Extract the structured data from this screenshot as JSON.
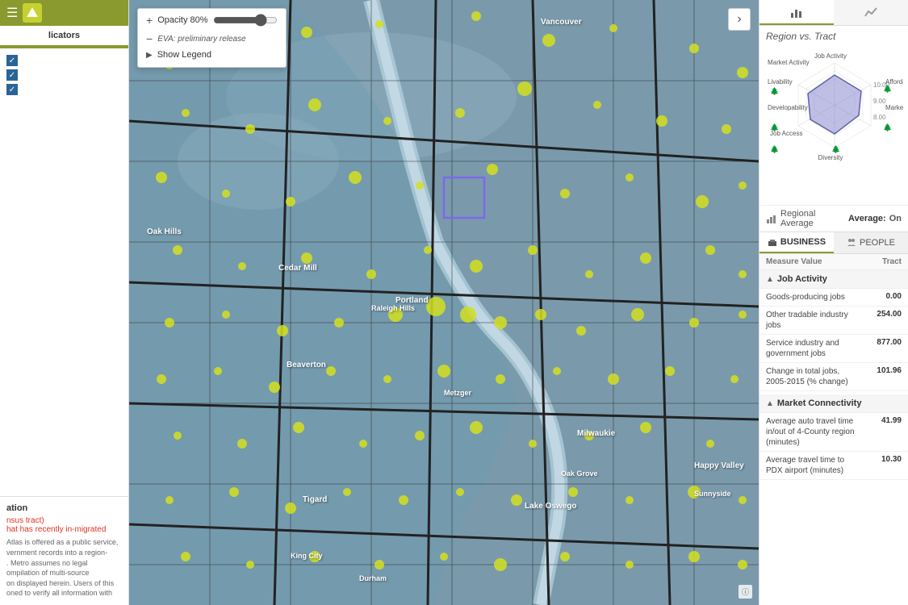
{
  "left_panel": {
    "indicators_title": "licators",
    "checkboxes": [
      {
        "id": "cb1",
        "checked": true
      },
      {
        "id": "cb2",
        "checked": true
      },
      {
        "id": "cb3",
        "checked": true
      }
    ],
    "bottom_info": {
      "title": "ation",
      "subtitle": "nsus tract)",
      "in_migrated_label": "hat has recently in-migrated",
      "text": "Atlas is offered as a public service,\nvernment records into a region-\n. Metro assumes no legal\nompilation of multi-source\non displayed herein. Users of this\noned to verify all information with"
    }
  },
  "opacity_popup": {
    "plus": "+",
    "minus": "−",
    "label": "Opacity 80%",
    "eva_label": "EVA: preliminary release",
    "show_legend": "Show Legend"
  },
  "map": {
    "cities": [
      "Vancouver",
      "Portland",
      "Beaverton",
      "Lake Oswego",
      "Tigard",
      "Happy Valley",
      "Milwaukie",
      "Oak Hills",
      "Cedar Mill",
      "Raleigh Hills",
      "King City",
      "Durham",
      "Oak Grove",
      "Sunnyside",
      "Metzger"
    ]
  },
  "right_panel": {
    "tabs": [
      {
        "id": "chart",
        "icon": "📊"
      },
      {
        "id": "line",
        "icon": "📈"
      }
    ],
    "region_vs_tract": "Region vs. Tract",
    "radar": {
      "labels": [
        {
          "key": "job_activity",
          "text": "Job Activity"
        },
        {
          "key": "affordability",
          "text": "Affordability"
        },
        {
          "key": "market_conn",
          "text": "Market Co..."
        },
        {
          "key": "diversity",
          "text": "Diversity"
        },
        {
          "key": "job_access",
          "text": "Job Access"
        },
        {
          "key": "developability",
          "text": "Developability"
        },
        {
          "key": "livability",
          "text": "Livability"
        },
        {
          "key": "market_activity",
          "text": "Market Activity"
        }
      ],
      "scale_labels": [
        "8.00",
        "9.00",
        "10.00"
      ],
      "average_label": "Regional Average",
      "average_on": "On"
    },
    "bp_tabs": [
      {
        "id": "business",
        "icon": "🏢",
        "label": "BUSINESS"
      },
      {
        "id": "people",
        "icon": "👥",
        "label": "PEOPLE"
      }
    ],
    "table_headers": {
      "measure": "Measure Value",
      "tract": "Tract"
    },
    "sections": [
      {
        "title": "Job Activity",
        "rows": [
          {
            "measure": "Goods-producing jobs",
            "value": "0.00"
          },
          {
            "measure": "Other tradable industry jobs",
            "value": "254.00"
          },
          {
            "measure": "Service industry and government jobs",
            "value": "877.00"
          },
          {
            "measure": "Change in total jobs, 2005-2015 (% change)",
            "value": "101.96"
          }
        ]
      },
      {
        "title": "Market Connectivity",
        "rows": [
          {
            "measure": "Average auto travel time in/out of 4-County region (minutes)",
            "value": "41.99"
          },
          {
            "measure": "Average travel time to PDX airport (minutes)",
            "value": "10.30"
          }
        ]
      }
    ]
  }
}
